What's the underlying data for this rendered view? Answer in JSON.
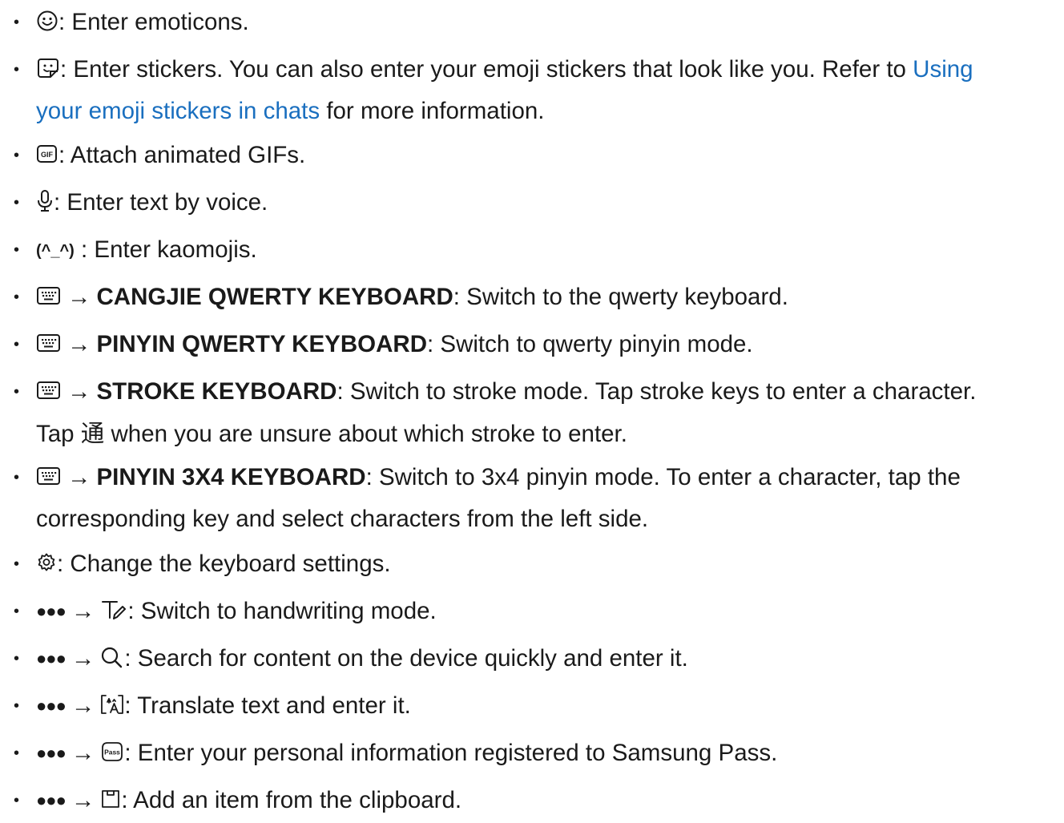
{
  "colors": {
    "text": "#1a1a1a",
    "link": "#1a6fbf"
  },
  "arrow": "→",
  "dots": "●●●",
  "items": [
    {
      "icon": "emoticon-icon",
      "desc": ": Enter emoticons."
    },
    {
      "icon": "sticker-icon",
      "desc_before": ": Enter stickers. You can also enter your emoji stickers that look like you. Refer to ",
      "link_line1": "Using",
      "link_line2": "your emoji stickers in chats",
      "desc_after": " for more information."
    },
    {
      "icon": "gif-icon",
      "desc": ": Attach animated GIFs."
    },
    {
      "icon": "microphone-icon",
      "desc": ": Enter text by voice."
    },
    {
      "icon": "kaomoji-icon",
      "kaomoji": "(^_^)",
      "desc": ": Enter kaomojis."
    },
    {
      "icon": "keyboard-icon",
      "option": "CANGJIE QWERTY KEYBOARD",
      "desc": ": Switch to the qwerty keyboard."
    },
    {
      "icon": "keyboard-icon",
      "option": "PINYIN QWERTY KEYBOARD",
      "desc": ": Switch to qwerty pinyin mode."
    },
    {
      "icon": "keyboard-icon",
      "option": "STROKE KEYBOARD",
      "desc": ": Switch to stroke mode. Tap stroke keys to enter a character.",
      "line2_before": "Tap ",
      "char": "通",
      "line2_after": " when you are unsure about which stroke to enter."
    },
    {
      "icon": "keyboard-icon",
      "option": "PINYIN 3X4 KEYBOARD",
      "desc": ": Switch to 3x4 pinyin mode. To enter a character, tap the",
      "line2": "corresponding key and select characters from the left side."
    },
    {
      "icon": "gear-icon",
      "desc": ": Change the keyboard settings."
    },
    {
      "icon": "handwriting-icon",
      "desc": ": Switch to handwriting mode."
    },
    {
      "icon": "search-icon",
      "desc": ": Search for content on the device quickly and enter it."
    },
    {
      "icon": "translate-icon",
      "desc": ": Translate text and enter it."
    },
    {
      "icon": "samsung-pass-icon",
      "pass_label": "Pass",
      "desc": ": Enter your personal information registered to Samsung Pass."
    },
    {
      "icon": "clipboard-icon",
      "desc": ": Add an item from the clipboard."
    }
  ]
}
